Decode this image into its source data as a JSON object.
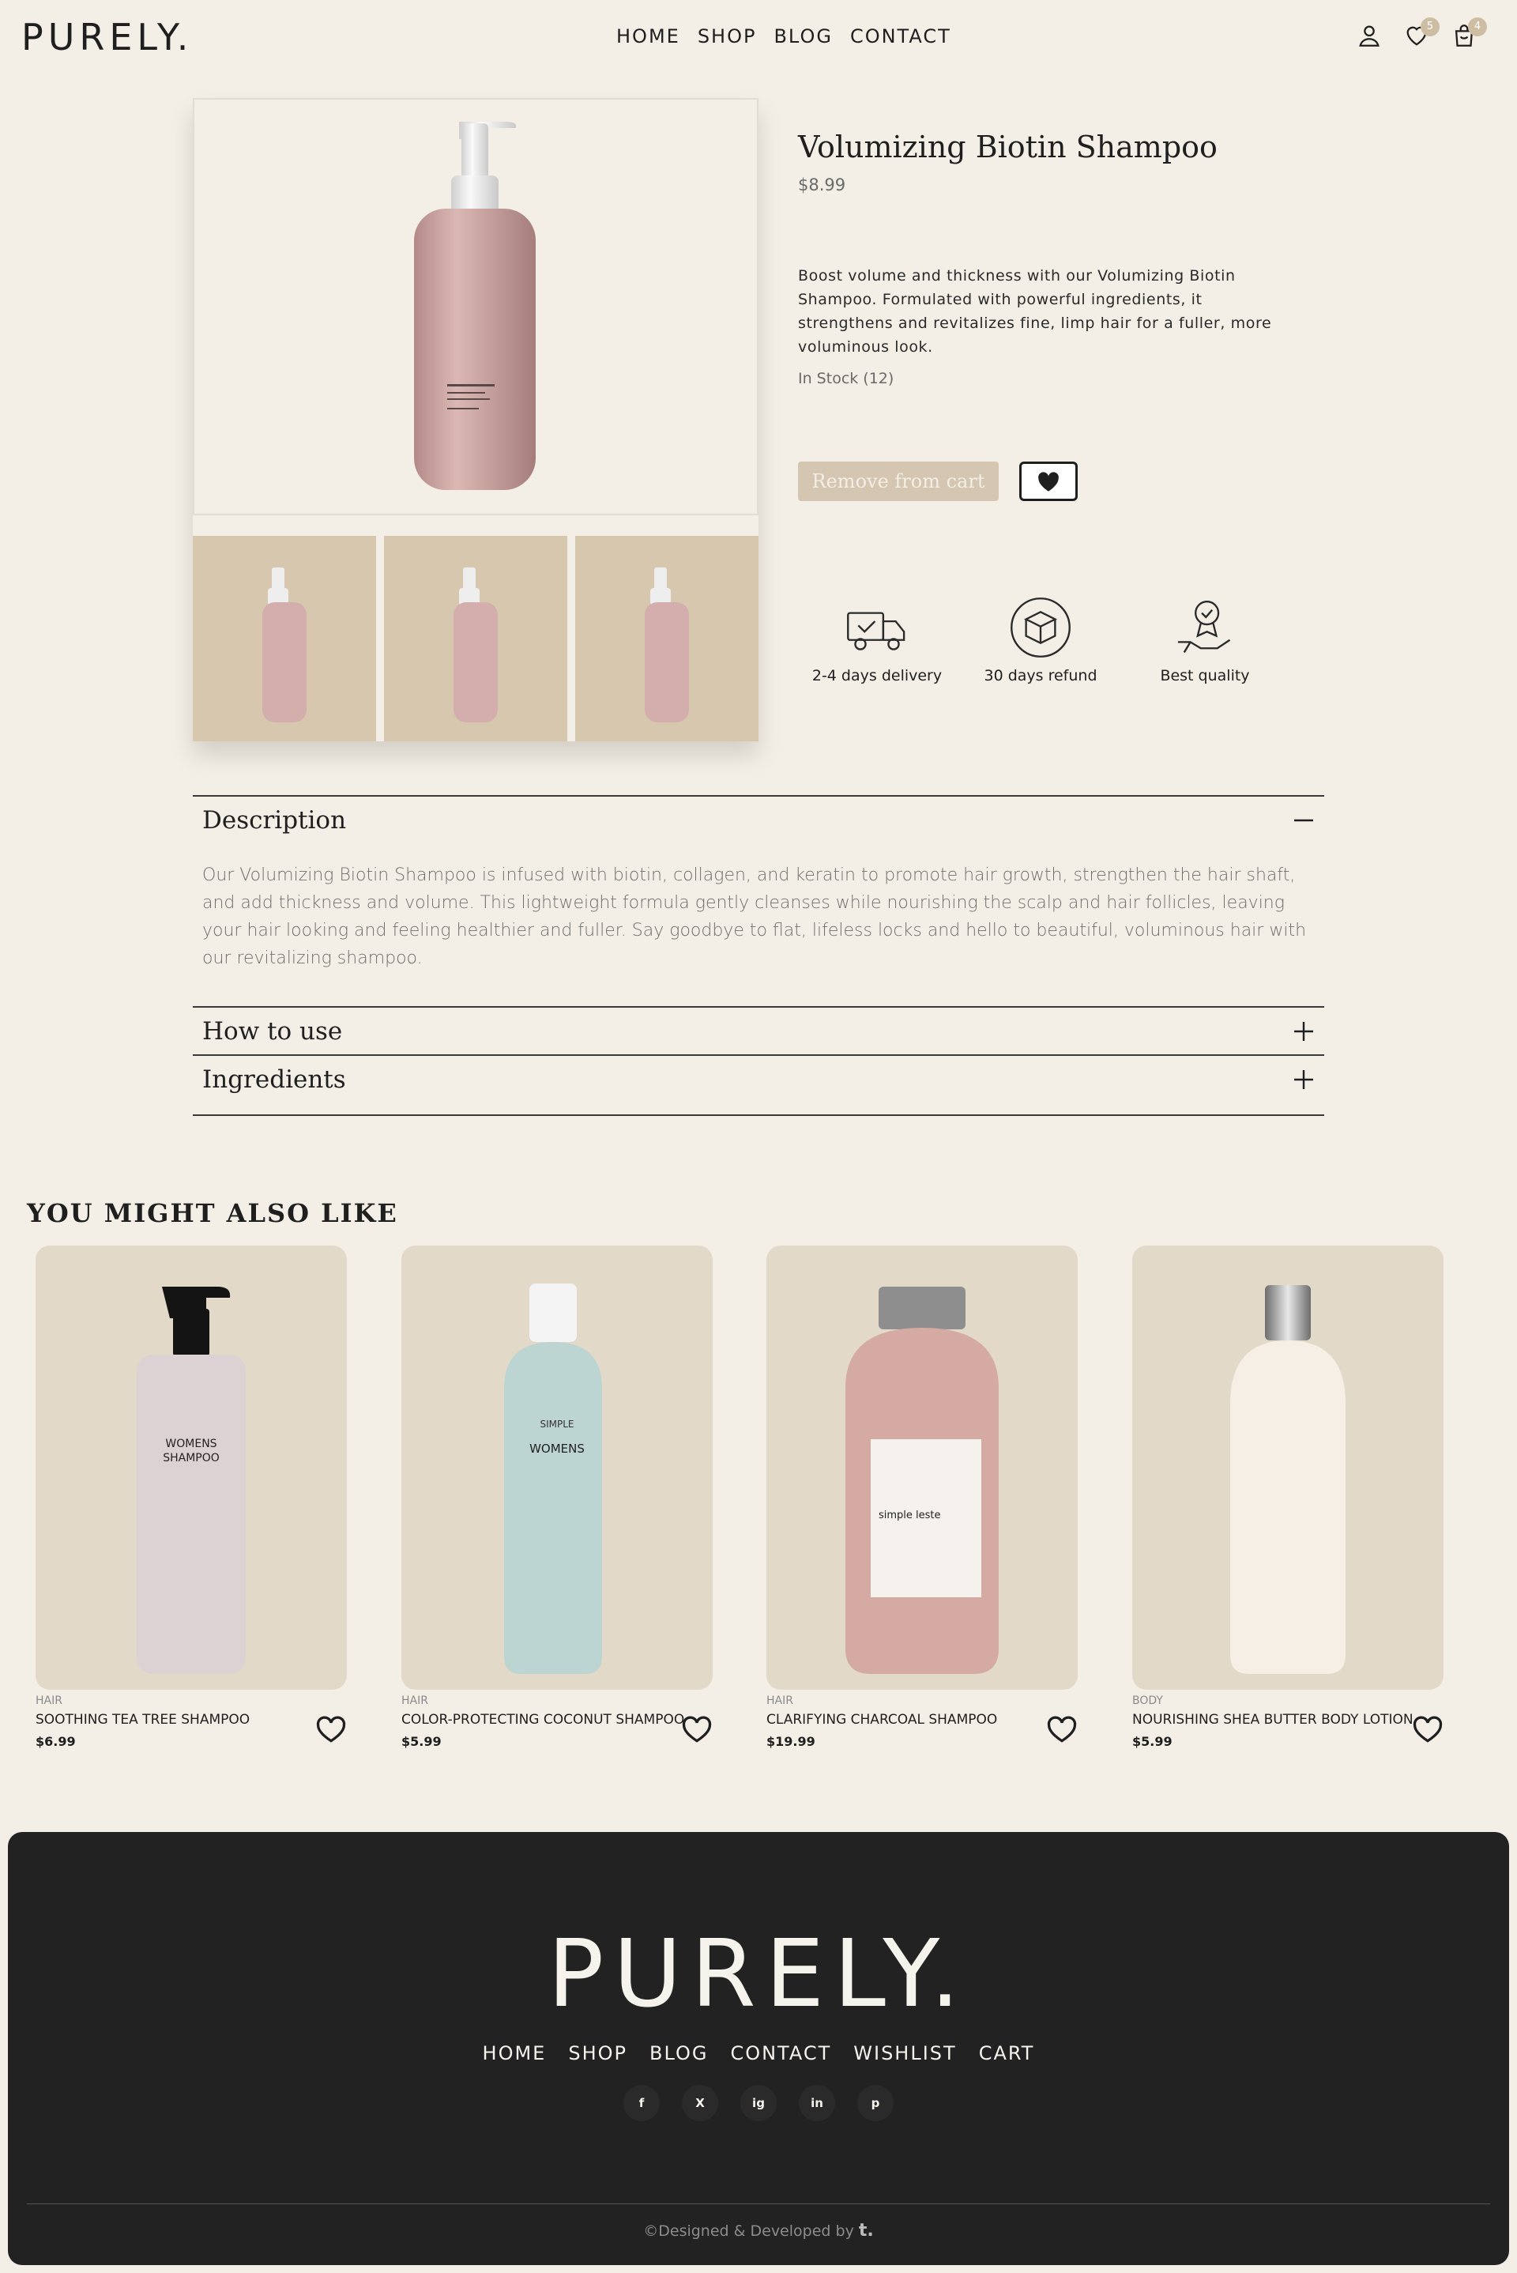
{
  "header": {
    "logo": "PURELY.",
    "nav": [
      "HOME",
      "SHOP",
      "BLOG",
      "CONTACT"
    ],
    "wishlist_count": "5",
    "cart_count": "4"
  },
  "product": {
    "title": "Volumizing Biotin Shampoo",
    "price": "$8.99",
    "description": "Boost volume and thickness with our Volumizing Biotin Shampoo. Formulated with powerful ingredients, it strengthens and revitalizes fine, limp hair for a fuller, more voluminous look.",
    "stock": "In Stock (12)",
    "remove_label": "Remove from cart",
    "features": [
      {
        "icon": "delivery-truck-icon",
        "label": "2-4 days delivery"
      },
      {
        "icon": "refund-box-icon",
        "label": "30 days refund"
      },
      {
        "icon": "quality-badge-icon",
        "label": "Best quality"
      }
    ]
  },
  "accordion": {
    "description": {
      "title": "Description",
      "body": "Our Volumizing Biotin Shampoo is infused with biotin, collagen, and keratin to promote hair growth, strengthen the hair shaft, and add thickness and volume. This lightweight formula gently cleanses while nourishing the scalp and hair follicles, leaving your hair looking and feeling healthier and fuller. Say goodbye to flat, lifeless locks and hello to beautiful, voluminous hair with our revitalizing shampoo."
    },
    "how_to_use": {
      "title": "How to use"
    },
    "ingredients": {
      "title": "Ingredients"
    }
  },
  "related": {
    "title": "YOU MIGHT ALSO LIKE",
    "items": [
      {
        "category": "HAIR",
        "name": "SOOTHING TEA TREE SHAMPOO",
        "price": "$6.99"
      },
      {
        "category": "HAIR",
        "name": "COLOR-PROTECTING COCONUT SHAMPOO",
        "price": "$5.99"
      },
      {
        "category": "HAIR",
        "name": "CLARIFYING CHARCOAL SHAMPOO",
        "price": "$19.99"
      },
      {
        "category": "BODY",
        "name": "NOURISHING SHEA BUTTER BODY LOTION",
        "price": "$5.99"
      }
    ]
  },
  "footer": {
    "logo": "PURELY.",
    "nav": [
      "HOME",
      "SHOP",
      "BLOG",
      "CONTACT",
      "WISHLIST",
      "CART"
    ],
    "social": [
      "f",
      "X",
      "ig",
      "in",
      "p"
    ],
    "copyright": "©Designed & Developed by",
    "developer_mark": "t."
  },
  "colors": {
    "background": "#f3efe6",
    "accent": "#d4c6b0",
    "footer": "#222222"
  }
}
